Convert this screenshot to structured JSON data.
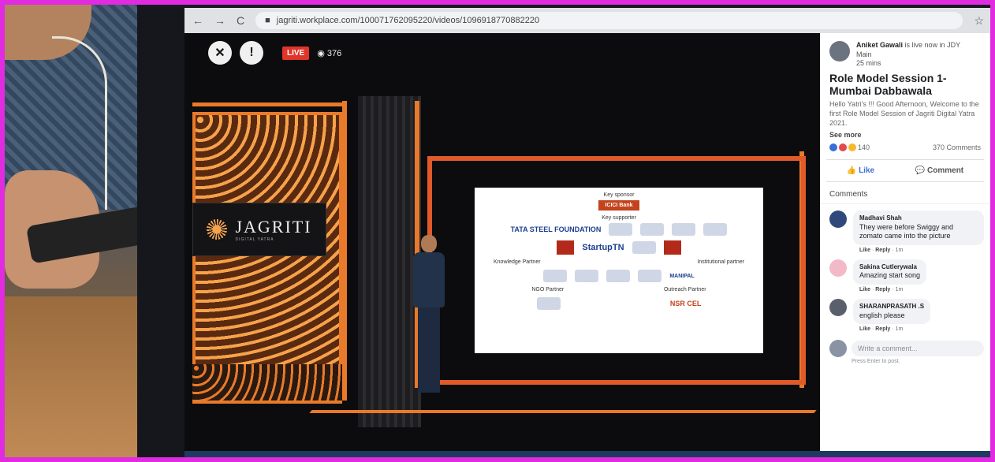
{
  "browser": {
    "url": "jagriti.workplace.com/100071762095220/videos/1096918770882220",
    "nav_back": "←",
    "nav_forward": "→",
    "nav_reload": "C"
  },
  "video": {
    "live_label": "LIVE",
    "viewers": "376",
    "brand": "JAGRITI",
    "brand_sub": "DIGITAL YATRA"
  },
  "slide": {
    "key_sponsor": "Key sponsor",
    "sponsor_name": "ICICI Bank",
    "key_supporter": "Key supporter",
    "tata": "TATA STEEL FOUNDATION",
    "startup": "StartupTN",
    "knowledge_partner": "Knowledge Partner",
    "institutional_partner": "Institutional partner",
    "ngo_partner": "NGO Partner",
    "outreach_partner": "Outreach Partner",
    "nsr": "NSR CEL",
    "manipal": "MANIPAL"
  },
  "post": {
    "author": "Aniket Gawali",
    "author_action": "is live now in JDY",
    "group": "Main",
    "time": "25 mins",
    "title": "Role Model Session 1- Mumbai Dabbawala",
    "description": "Hello Yatri's !!! Good Afternoon, Welcome to the first Role Model Session of Jagriti Digital Yatra 2021.",
    "see_more": "See more",
    "reaction_count": "140",
    "comment_count": "370 Comments",
    "like_label": "Like",
    "comment_label": "Comment"
  },
  "comments": {
    "header": "Comments",
    "items": [
      {
        "name": "Madhavi Shah",
        "text": "They were before Swiggy and zomato came into the picture",
        "meta_like": "Like",
        "meta_reply": "Reply",
        "meta_time": "1m"
      },
      {
        "name": "Sakina Cutlerywala",
        "text": "Amazing start song",
        "meta_like": "Like",
        "meta_reply": "Reply",
        "meta_time": "1m"
      },
      {
        "name": "SHARANPRASATH .S",
        "text": "english please",
        "meta_like": "Like",
        "meta_reply": "Reply",
        "meta_time": "1m"
      }
    ],
    "write_placeholder": "Write a comment...",
    "hint": "Press Enter to post."
  },
  "colors": {
    "frame_border": "#e02be0",
    "live_red": "#e0352b",
    "stage_orange": "#e87a2a",
    "fb_blue": "#3a6fd8"
  }
}
